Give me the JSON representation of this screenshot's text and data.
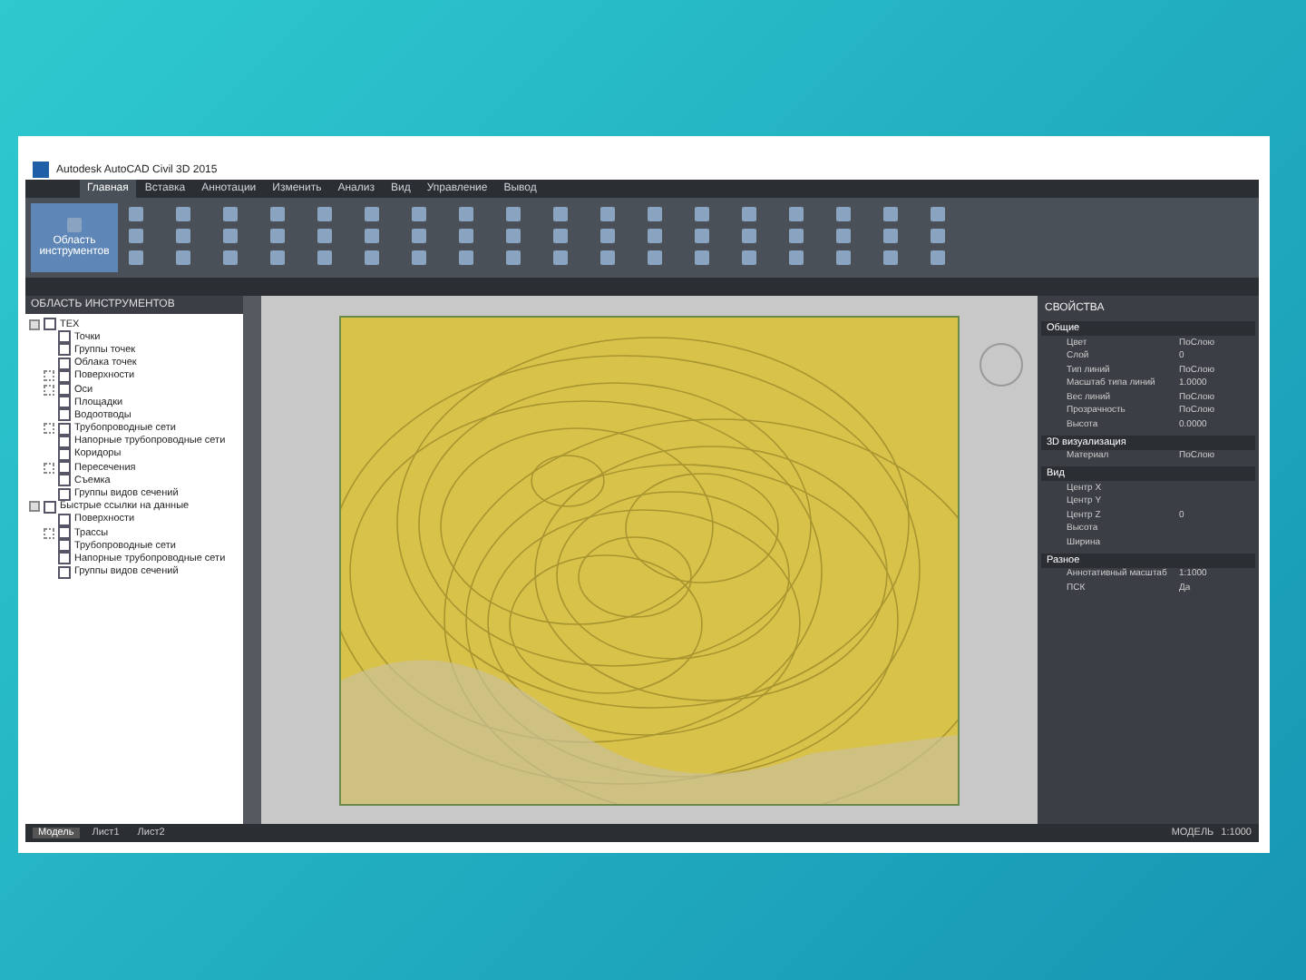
{
  "window": {
    "title": "Autodesk AutoCAD Civil 3D 2015"
  },
  "ribbon_tabs": [
    {
      "label": "Главная",
      "selected": true
    },
    {
      "label": "Вставка",
      "selected": false
    },
    {
      "label": "Аннотации",
      "selected": false
    },
    {
      "label": "Изменить",
      "selected": false
    },
    {
      "label": "Анализ",
      "selected": false
    },
    {
      "label": "Вид",
      "selected": false
    },
    {
      "label": "Управление",
      "selected": false
    },
    {
      "label": "Вывод",
      "selected": false
    }
  ],
  "ribbon_button": "Область инструментов",
  "toolspace": {
    "title": "ОБЛАСТЬ ИНСТРУМЕНТОВ",
    "tree": [
      {
        "label": "ТЕХ",
        "expanded": true,
        "children": [
          {
            "label": "Точки"
          },
          {
            "label": "Группы точек"
          },
          {
            "label": "Облака точек"
          },
          {
            "label": "Поверхности",
            "expanded": false
          },
          {
            "label": "Оси",
            "expanded": false
          },
          {
            "label": "Площадки"
          },
          {
            "label": "Водоотводы"
          },
          {
            "label": "Трубопроводные сети",
            "expanded": false
          },
          {
            "label": "Напорные трубопроводные сети"
          },
          {
            "label": "Коридоры"
          },
          {
            "label": "Пересечения",
            "expanded": false
          },
          {
            "label": "Съемка"
          },
          {
            "label": "Группы видов сечений"
          }
        ]
      },
      {
        "label": "Быстрые ссылки на данные",
        "expanded": true,
        "children": [
          {
            "label": "Поверхности"
          },
          {
            "label": "Трассы",
            "expanded": false
          },
          {
            "label": "Трубопроводные сети"
          },
          {
            "label": "Напорные трубопроводные сети"
          },
          {
            "label": "Группы видов сечений"
          }
        ]
      }
    ]
  },
  "properties": {
    "title": "СВОЙСТВА",
    "sections": [
      {
        "title": "Общие",
        "rows": [
          {
            "name": "Цвет",
            "value": "ПоСлою"
          },
          {
            "name": "Слой",
            "value": "0"
          },
          {
            "name": "Тип линий",
            "value": "ПоСлою"
          },
          {
            "name": "Масштаб типа линий",
            "value": "1.0000"
          },
          {
            "name": "Вес линий",
            "value": "ПоСлою"
          },
          {
            "name": "Прозрачность",
            "value": "ПоСлою"
          },
          {
            "name": "Высота",
            "value": "0.0000"
          }
        ]
      },
      {
        "title": "3D визуализация",
        "rows": [
          {
            "name": "Материал",
            "value": "ПоСлою"
          }
        ]
      },
      {
        "title": "Вид",
        "rows": [
          {
            "name": "Центр X"
          },
          {
            "name": "Центр Y"
          },
          {
            "name": "Центр Z",
            "value": "0"
          },
          {
            "name": "Высота"
          },
          {
            "name": "Ширина"
          }
        ]
      },
      {
        "title": "Разное",
        "rows": [
          {
            "name": "Аннотативный масштаб",
            "value": "1:1000"
          },
          {
            "name": "ПСК",
            "value": "Да"
          }
        ]
      }
    ]
  },
  "layout_tabs": [
    {
      "label": "Модель",
      "selected": true
    },
    {
      "label": "Лист1",
      "selected": false
    },
    {
      "label": "Лист2",
      "selected": false
    }
  ],
  "status": {
    "mode": "МОДЕЛЬ",
    "scale": "1:1000"
  }
}
